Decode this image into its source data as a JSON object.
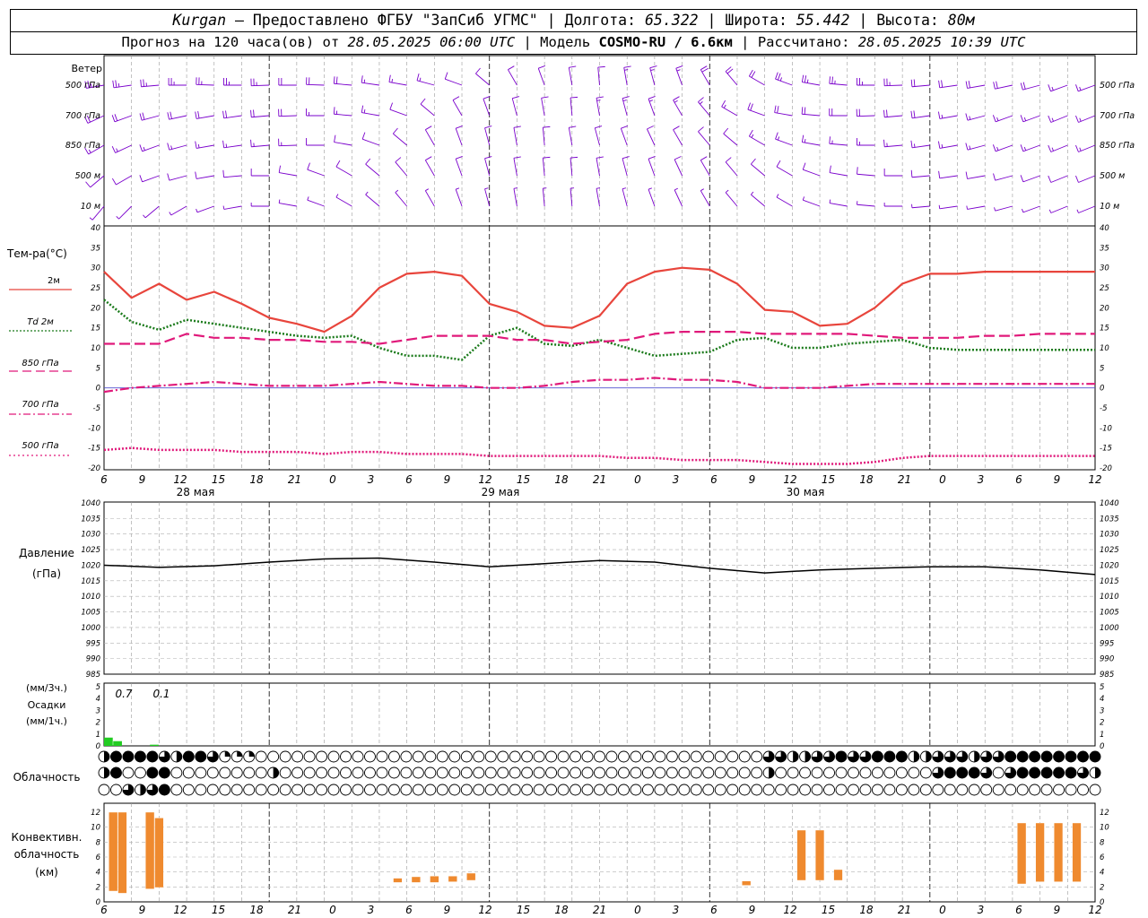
{
  "header": {
    "station": "Kurgan",
    "provider": "Предоставлено ФГБУ \"ЗапСиб УГМС\"",
    "lon_label": "Долгота:",
    "lon": "65.322",
    "lat_label": "Широта:",
    "lat": "55.442",
    "alt_label": "Высота:",
    "alt": "80м",
    "forecast_label": "Прогноз на 120 часа(ов) от",
    "forecast_start": "28.05.2025 06:00 UTC",
    "model_label": "Модель",
    "model": "COSMO-RU / 6.6км",
    "calc_label": "Рассчитано:",
    "calc_time": "28.05.2025 10:39 UTC"
  },
  "x_ticks": [
    "6",
    "9",
    "12",
    "15",
    "18",
    "21",
    "0",
    "3",
    "6",
    "9",
    "12",
    "15",
    "18",
    "21",
    "0",
    "3",
    "6",
    "9",
    "12",
    "15",
    "18",
    "21",
    "0",
    "3",
    "6",
    "9",
    "12"
  ],
  "dates": [
    "28 мая",
    "29 мая",
    "30 мая"
  ],
  "wind_panel": {
    "title": "Ветер",
    "levels": [
      "500 гПа",
      "700 гПа",
      "850 гПа",
      "500 м",
      "10 м"
    ],
    "barb_color": "#7a00cc"
  },
  "temp_panel": {
    "title": "Тем-ра(°C)",
    "legend": [
      "2м",
      "Td 2м",
      "850 гПа",
      "700 гПа",
      "500 гПа"
    ],
    "y_ticks": [
      "40",
      "35",
      "30",
      "25",
      "20",
      "15",
      "10",
      "5",
      "0",
      "-5",
      "-10",
      "-15",
      "-20"
    ]
  },
  "pressure_panel": {
    "title_1": "Давление",
    "title_2": "(гПа)",
    "y_ticks": [
      "1040",
      "1035",
      "1030",
      "1025",
      "1020",
      "1015",
      "1010",
      "1005",
      "1000",
      "995",
      "990",
      "985"
    ]
  },
  "precip_panel": {
    "title_1": "(мм/3ч.)",
    "title_2": "Осадки",
    "title_3": "(мм/1ч.)",
    "y_ticks": [
      "5",
      "4",
      "3",
      "2",
      "1",
      "0"
    ],
    "annotations": [
      "0.7",
      "0.1"
    ]
  },
  "cloud_panel": {
    "title": "Облачность"
  },
  "conv_panel": {
    "title_1": "Конвективн.",
    "title_2": "облачность",
    "title_3": "(км)",
    "y_ticks": [
      "12",
      "10",
      "8",
      "6",
      "4",
      "2",
      "0"
    ],
    "color": "#ef8a2f"
  },
  "chart_data": [
    {
      "type": "line",
      "title": "Тем-ра(°C)",
      "xlabel": "",
      "ylabel": "",
      "ylim": [
        -20,
        40
      ],
      "x_hours": [
        0,
        3,
        6,
        9,
        12,
        15,
        18,
        21,
        24,
        27,
        30,
        33,
        36,
        39,
        42,
        45,
        48,
        51,
        54,
        57,
        60,
        63,
        66,
        69,
        72,
        75,
        78,
        81,
        84,
        87,
        90,
        93,
        96,
        99,
        102,
        105,
        108
      ],
      "series": [
        {
          "name": "2м",
          "color": "#e8453c",
          "style": "solid",
          "values": [
            29,
            22.5,
            26,
            22,
            24,
            21,
            17.5,
            16,
            14,
            18,
            25,
            28.5,
            29,
            28,
            21,
            19,
            15.5,
            15,
            18,
            26,
            29,
            30,
            29.5,
            26,
            19.5,
            19,
            15.5,
            16,
            20,
            26,
            28.5,
            28.5,
            29,
            29,
            29,
            29,
            29
          ]
        },
        {
          "name": "Td 2м",
          "color": "#1a7a1a",
          "style": "dotted",
          "values": [
            22,
            16.5,
            14.5,
            17,
            16,
            15,
            14,
            13,
            12.5,
            13,
            10,
            8,
            8,
            7,
            13,
            15,
            11,
            10.5,
            12,
            10,
            8,
            8.5,
            9,
            12,
            12.5,
            10,
            10,
            11,
            11.5,
            12,
            10,
            9.5,
            9.5,
            9.5,
            9.5,
            9.5,
            9.5
          ]
        },
        {
          "name": "850 гПа",
          "color": "#e0197a",
          "style": "dashed",
          "values": [
            11,
            11,
            11,
            13.5,
            12.5,
            12.5,
            12,
            12,
            11.5,
            11.5,
            11,
            12,
            13,
            13,
            13,
            12,
            12,
            11,
            11.5,
            12,
            13.5,
            14,
            14,
            14,
            13.5,
            13.5,
            13.5,
            13.5,
            13,
            12.5,
            12.5,
            12.5,
            13,
            13,
            13.5,
            13.5,
            13.5
          ]
        },
        {
          "name": "700 гПа",
          "color": "#e0197a",
          "style": "dashdot",
          "values": [
            -1,
            0,
            0.5,
            1,
            1.5,
            1,
            0.5,
            0.5,
            0.5,
            1,
            1.5,
            1,
            0.5,
            0.5,
            0,
            0,
            0.5,
            1.5,
            2,
            2,
            2.5,
            2,
            2,
            1.5,
            0,
            0,
            0,
            0.5,
            1,
            1,
            1,
            1,
            1,
            1,
            1,
            1,
            1
          ]
        },
        {
          "name": "500 гПа",
          "color": "#e0197a",
          "style": "dotted",
          "values": [
            -15.5,
            -15,
            -15.5,
            -15.5,
            -15.5,
            -16,
            -16,
            -16,
            -16.5,
            -16,
            -16,
            -16.5,
            -16.5,
            -16.5,
            -17,
            -17,
            -17,
            -17,
            -17,
            -17.5,
            -17.5,
            -18,
            -18,
            -18,
            -18.5,
            -19,
            -19,
            -19,
            -18.5,
            -17.5,
            -17,
            -17,
            -17,
            -17,
            -17,
            -17,
            -17
          ]
        }
      ]
    },
    {
      "type": "line",
      "title": "Давление",
      "ylabel": "(гПа)",
      "ylim": [
        985,
        1040
      ],
      "x_hours": [
        0,
        6,
        12,
        18,
        24,
        30,
        36,
        42,
        48,
        54,
        60,
        66,
        72,
        78,
        84,
        90,
        96,
        102,
        108
      ],
      "series": [
        {
          "name": "",
          "color": "#000000",
          "values": [
            1020,
            1019.3,
            1019.8,
            1021,
            1022,
            1022.3,
            1021,
            1019.5,
            1020.5,
            1021.5,
            1021,
            1019,
            1017.5,
            1018.5,
            1019,
            1019.5,
            1019.5,
            1018.5,
            1017
          ]
        }
      ]
    },
    {
      "type": "bar",
      "title": "Осадки",
      "unit": "мм/1ч.",
      "x_hours": [
        0,
        1,
        2,
        3,
        4,
        5,
        6
      ],
      "values": [
        0.7,
        0.4,
        0,
        0,
        0,
        0.1,
        0
      ],
      "totals_3h": [
        {
          "x_hours": 1,
          "value": 0.7
        },
        {
          "x_hours": 5,
          "value": 0.1
        }
      ],
      "ylim": [
        0,
        5
      ]
    },
    {
      "type": "bar",
      "title": "Конвективн. облачность",
      "unit": "км",
      "ylim": [
        0,
        12.5
      ],
      "bars": [
        {
          "x_hours": 1,
          "bottom": 1.5,
          "top": 12.5
        },
        {
          "x_hours": 2,
          "bottom": 1.2,
          "top": 12.5
        },
        {
          "x_hours": 5,
          "bottom": 1.8,
          "top": 12.5
        },
        {
          "x_hours": 6,
          "bottom": 2.0,
          "top": 11.7
        },
        {
          "x_hours": 32,
          "bottom": 2.7,
          "top": 3.3
        },
        {
          "x_hours": 34,
          "bottom": 2.7,
          "top": 3.5
        },
        {
          "x_hours": 36,
          "bottom": 2.7,
          "top": 3.6
        },
        {
          "x_hours": 38,
          "bottom": 2.8,
          "top": 3.6
        },
        {
          "x_hours": 40,
          "bottom": 3.0,
          "top": 4.0
        },
        {
          "x_hours": 70,
          "bottom": 2.3,
          "top": 2.9
        },
        {
          "x_hours": 76,
          "bottom": 3.0,
          "top": 10.0
        },
        {
          "x_hours": 78,
          "bottom": 3.0,
          "top": 10.0
        },
        {
          "x_hours": 80,
          "bottom": 3.0,
          "top": 4.5
        },
        {
          "x_hours": 100,
          "bottom": 2.5,
          "top": 11.0
        },
        {
          "x_hours": 102,
          "bottom": 2.8,
          "top": 11.0
        },
        {
          "x_hours": 104,
          "bottom": 2.8,
          "top": 11.0
        },
        {
          "x_hours": 106,
          "bottom": 2.8,
          "top": 11.0
        }
      ]
    }
  ],
  "cloud_rows": {
    "top": [
      0.5,
      1,
      1,
      1,
      1,
      0.75,
      0.5,
      1,
      1,
      0.75,
      0.25,
      0.25,
      0.25,
      0,
      0,
      0,
      0,
      0,
      0,
      0,
      0,
      0,
      0,
      0,
      0,
      0,
      0,
      0,
      0,
      0,
      0,
      0,
      0,
      0,
      0,
      0,
      0,
      0,
      0,
      0,
      0,
      0,
      0,
      0,
      0,
      0,
      0,
      0,
      0,
      0,
      0,
      0,
      0,
      0,
      0,
      0.75,
      0.75,
      0.5,
      0.5,
      0.75,
      0.75,
      1,
      0.75,
      0.75,
      1,
      1,
      1,
      0.5,
      0.5,
      0.75,
      0.75,
      0.75,
      0.5,
      0.75,
      0.75,
      1,
      1,
      1,
      1,
      1,
      1,
      1,
      1
    ],
    "middle": [
      0.5,
      1,
      0,
      0,
      1,
      1,
      0,
      0,
      0,
      0,
      0,
      0,
      0,
      0,
      0.5,
      0,
      0,
      0,
      0,
      0,
      0,
      0,
      0,
      0,
      0,
      0,
      0,
      0,
      0,
      0,
      0,
      0,
      0,
      0,
      0,
      0,
      0,
      0,
      0,
      0,
      0,
      0,
      0,
      0,
      0,
      0,
      0,
      0,
      0,
      0,
      0,
      0,
      0,
      0,
      0,
      0.5,
      0,
      0,
      0,
      0,
      0,
      0,
      0,
      0,
      0,
      0,
      0,
      0,
      0,
      0.75,
      1,
      1,
      1,
      0.75,
      0,
      0.75,
      1,
      1,
      1,
      1,
      1,
      0.75,
      0.5
    ],
    "bottom": [
      0,
      0,
      0.75,
      0.5,
      0.75,
      1,
      0,
      0,
      0,
      0,
      0,
      0,
      0,
      0,
      0,
      0,
      0,
      0,
      0,
      0,
      0,
      0,
      0,
      0,
      0,
      0,
      0,
      0,
      0,
      0,
      0,
      0,
      0,
      0,
      0,
      0,
      0,
      0,
      0,
      0,
      0,
      0,
      0,
      0,
      0,
      0,
      0,
      0,
      0,
      0,
      0,
      0,
      0,
      0,
      0,
      0,
      0,
      0,
      0,
      0,
      0,
      0,
      0,
      0,
      0,
      0,
      0,
      0,
      0,
      0,
      0,
      0,
      0,
      0,
      0,
      0,
      0,
      0,
      0,
      0,
      0,
      0,
      0
    ]
  },
  "wind_barbs": {
    "500 гПа": [
      [
        260,
        25
      ],
      [
        262,
        25
      ],
      [
        265,
        25
      ],
      [
        270,
        25
      ],
      [
        272,
        25
      ],
      [
        270,
        25
      ],
      [
        268,
        25
      ],
      [
        270,
        20
      ],
      [
        272,
        20
      ],
      [
        275,
        20
      ],
      [
        278,
        15
      ],
      [
        280,
        15
      ],
      [
        285,
        15
      ],
      [
        290,
        10
      ],
      [
        310,
        10
      ],
      [
        330,
        10
      ],
      [
        340,
        10
      ],
      [
        350,
        10
      ],
      [
        355,
        10
      ],
      [
        350,
        15
      ],
      [
        345,
        15
      ],
      [
        340,
        15
      ],
      [
        330,
        20
      ],
      [
        320,
        20
      ],
      [
        300,
        20
      ],
      [
        290,
        25
      ],
      [
        280,
        25
      ],
      [
        275,
        25
      ],
      [
        270,
        25
      ],
      [
        268,
        25
      ],
      [
        265,
        20
      ],
      [
        262,
        20
      ],
      [
        260,
        20
      ],
      [
        258,
        20
      ],
      [
        255,
        20
      ],
      [
        250,
        15
      ],
      [
        250,
        15
      ]
    ],
    "700 гПа": [
      [
        245,
        20
      ],
      [
        250,
        20
      ],
      [
        255,
        20
      ],
      [
        258,
        20
      ],
      [
        260,
        20
      ],
      [
        262,
        20
      ],
      [
        265,
        20
      ],
      [
        268,
        20
      ],
      [
        270,
        15
      ],
      [
        275,
        15
      ],
      [
        280,
        15
      ],
      [
        290,
        10
      ],
      [
        310,
        10
      ],
      [
        330,
        10
      ],
      [
        340,
        10
      ],
      [
        345,
        10
      ],
      [
        350,
        10
      ],
      [
        355,
        10
      ],
      [
        350,
        15
      ],
      [
        345,
        15
      ],
      [
        340,
        15
      ],
      [
        330,
        15
      ],
      [
        320,
        15
      ],
      [
        300,
        15
      ],
      [
        290,
        20
      ],
      [
        280,
        20
      ],
      [
        275,
        20
      ],
      [
        270,
        20
      ],
      [
        268,
        20
      ],
      [
        265,
        20
      ],
      [
        262,
        20
      ],
      [
        260,
        15
      ],
      [
        255,
        15
      ],
      [
        250,
        15
      ],
      [
        250,
        15
      ],
      [
        248,
        15
      ],
      [
        248,
        15
      ]
    ],
    "850 гПа": [
      [
        240,
        15
      ],
      [
        245,
        15
      ],
      [
        250,
        15
      ],
      [
        255,
        15
      ],
      [
        260,
        15
      ],
      [
        262,
        15
      ],
      [
        265,
        15
      ],
      [
        268,
        15
      ],
      [
        270,
        10
      ],
      [
        280,
        10
      ],
      [
        290,
        10
      ],
      [
        310,
        10
      ],
      [
        330,
        10
      ],
      [
        340,
        10
      ],
      [
        345,
        10
      ],
      [
        350,
        10
      ],
      [
        355,
        10
      ],
      [
        350,
        10
      ],
      [
        345,
        10
      ],
      [
        340,
        10
      ],
      [
        335,
        10
      ],
      [
        330,
        10
      ],
      [
        320,
        10
      ],
      [
        310,
        10
      ],
      [
        300,
        15
      ],
      [
        290,
        15
      ],
      [
        280,
        15
      ],
      [
        275,
        15
      ],
      [
        270,
        15
      ],
      [
        265,
        15
      ],
      [
        262,
        15
      ],
      [
        260,
        15
      ],
      [
        255,
        15
      ],
      [
        250,
        15
      ],
      [
        250,
        15
      ],
      [
        248,
        15
      ],
      [
        248,
        15
      ]
    ],
    "500 м": [
      [
        230,
        10
      ],
      [
        240,
        10
      ],
      [
        250,
        10
      ],
      [
        255,
        10
      ],
      [
        260,
        10
      ],
      [
        265,
        10
      ],
      [
        270,
        10
      ],
      [
        280,
        10
      ],
      [
        290,
        10
      ],
      [
        300,
        10
      ],
      [
        310,
        10
      ],
      [
        320,
        10
      ],
      [
        330,
        10
      ],
      [
        340,
        10
      ],
      [
        345,
        10
      ],
      [
        350,
        10
      ],
      [
        355,
        10
      ],
      [
        355,
        10
      ],
      [
        350,
        10
      ],
      [
        345,
        10
      ],
      [
        340,
        10
      ],
      [
        335,
        10
      ],
      [
        330,
        10
      ],
      [
        320,
        10
      ],
      [
        310,
        10
      ],
      [
        300,
        10
      ],
      [
        290,
        10
      ],
      [
        280,
        10
      ],
      [
        275,
        10
      ],
      [
        270,
        10
      ],
      [
        265,
        10
      ],
      [
        262,
        10
      ],
      [
        260,
        10
      ],
      [
        255,
        10
      ],
      [
        250,
        10
      ],
      [
        248,
        10
      ],
      [
        248,
        10
      ]
    ],
    "10 м": [
      [
        220,
        5
      ],
      [
        225,
        5
      ],
      [
        230,
        5
      ],
      [
        240,
        5
      ],
      [
        250,
        5
      ],
      [
        260,
        5
      ],
      [
        270,
        5
      ],
      [
        280,
        5
      ],
      [
        290,
        5
      ],
      [
        300,
        5
      ],
      [
        310,
        5
      ],
      [
        320,
        5
      ],
      [
        330,
        5
      ],
      [
        340,
        5
      ],
      [
        345,
        5
      ],
      [
        350,
        5
      ],
      [
        355,
        5
      ],
      [
        355,
        5
      ],
      [
        350,
        5
      ],
      [
        345,
        5
      ],
      [
        340,
        5
      ],
      [
        335,
        5
      ],
      [
        330,
        5
      ],
      [
        320,
        5
      ],
      [
        310,
        5
      ],
      [
        300,
        5
      ],
      [
        290,
        5
      ],
      [
        280,
        5
      ],
      [
        275,
        5
      ],
      [
        270,
        5
      ],
      [
        265,
        5
      ],
      [
        262,
        5
      ],
      [
        260,
        5
      ],
      [
        255,
        5
      ],
      [
        250,
        5
      ],
      [
        248,
        5
      ],
      [
        248,
        5
      ]
    ]
  }
}
